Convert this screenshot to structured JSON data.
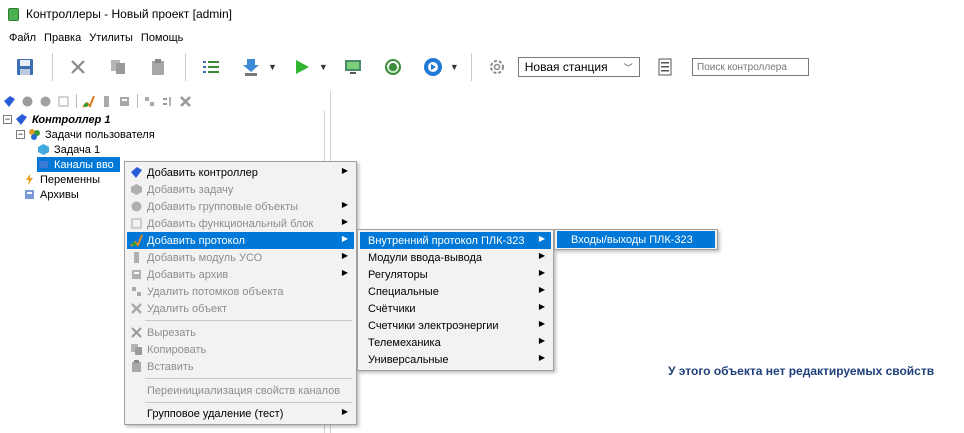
{
  "window": {
    "title": "Контроллеры - Новый проект [admin]"
  },
  "menubar": [
    "Файл",
    "Правка",
    "Утилиты",
    "Помощь"
  ],
  "toolbar": {
    "station_value": "Новая станция",
    "search_placeholder": "Поиск контроллера"
  },
  "tree": {
    "controller": "Контроллер 1",
    "user_tasks": "Задачи пользователя",
    "task1": "Задача 1",
    "channels_partial": "Каналы вво",
    "variables_partial": "Переменны",
    "archives": "Архивы"
  },
  "properties": {
    "message": "У этого объекта нет редактируемых свойств"
  },
  "context_menu": {
    "items": [
      {
        "label": "Добавить контроллер",
        "icon": "controller-icon",
        "disabled": false,
        "submenu": true
      },
      {
        "label": "Добавить задачу",
        "icon": "task-icon",
        "disabled": true,
        "submenu": false
      },
      {
        "label": "Добавить групповые объекты",
        "icon": "group-icon",
        "disabled": true,
        "submenu": true
      },
      {
        "label": "Добавить функциональный блок",
        "icon": "function-block-icon",
        "disabled": true,
        "submenu": true
      },
      {
        "label": "Добавить протокол",
        "icon": "protocol-icon",
        "disabled": false,
        "submenu": true
      },
      {
        "label": "Добавить модуль УСО",
        "icon": "module-icon",
        "disabled": true,
        "submenu": true
      },
      {
        "label": "Добавить архив",
        "icon": "archive-icon",
        "disabled": true,
        "submenu": true
      },
      {
        "label": "Удалить потомков объекта",
        "icon": "delete-children-icon",
        "disabled": true,
        "submenu": false
      },
      {
        "label": "Удалить объект",
        "icon": "delete-icon",
        "disabled": true,
        "submenu": false
      },
      {
        "label": "Вырезать",
        "icon": "cut-icon",
        "disabled": true,
        "submenu": false
      },
      {
        "label": "Копировать",
        "icon": "copy-icon",
        "disabled": true,
        "submenu": false
      },
      {
        "label": "Вставить",
        "icon": "paste-icon",
        "disabled": true,
        "submenu": false
      },
      {
        "label": "Переинициализация свойств каналов",
        "icon": "",
        "disabled": true,
        "submenu": false
      },
      {
        "label": "Групповое удаление (тест)",
        "icon": "",
        "disabled": false,
        "submenu": true
      }
    ]
  },
  "protocol_submenu": {
    "items": [
      "Внутренний протокол ПЛК-323",
      "Модули ввода-вывода",
      "Регуляторы",
      "Специальные",
      "Счётчики",
      "Счетчики электроэнергии",
      "Телемеханика",
      "Универсальные"
    ]
  },
  "plc_submenu": {
    "items": [
      "Входы/выходы ПЛК-323"
    ]
  },
  "colors": {
    "accent": "#0078d7",
    "message": "#1f3f7a"
  }
}
